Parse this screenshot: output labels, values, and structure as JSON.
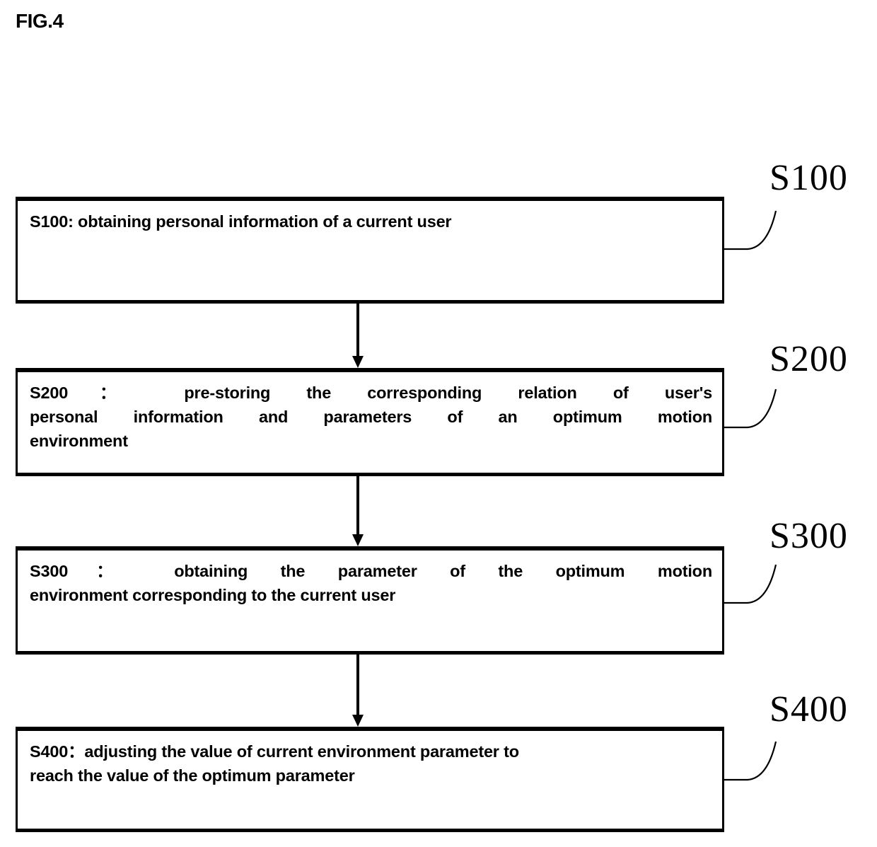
{
  "figure": {
    "title": "FIG.4",
    "type": "patent-flowchart",
    "background_color": "#ffffff",
    "line_color": "#000000"
  },
  "steps": [
    {
      "id": "S100",
      "ref_label": "S100",
      "text": "S100: obtaining personal information of a current user",
      "lines": [
        "S100: obtaining personal information of a current user"
      ]
    },
    {
      "id": "S200",
      "ref_label": "S200",
      "text": "S200： pre-storing the corresponding relation of user's personal information and parameters of an optimum motion environment",
      "lines": [
        "S200： pre-storing the corresponding relation of user's",
        "personal information and parameters of an optimum motion",
        "environment"
      ]
    },
    {
      "id": "S300",
      "ref_label": "S300",
      "text": "S300： obtaining the parameter of the optimum motion environment corresponding to the current user",
      "lines": [
        "S300： obtaining the parameter of the optimum motion",
        "environment corresponding to the current user"
      ]
    },
    {
      "id": "S400",
      "ref_label": "S400",
      "text": "S400：adjusting the value of current environment parameter to reach the value of the optimum parameter",
      "lines": [
        "S400：adjusting the value of current environment parameter to",
        "reach the value of the optimum parameter"
      ]
    }
  ],
  "connectors": [
    {
      "from": "S100",
      "to": "S200",
      "style": "arrow-down"
    },
    {
      "from": "S200",
      "to": "S300",
      "style": "arrow-down"
    },
    {
      "from": "S300",
      "to": "S400",
      "style": "arrow-down"
    }
  ]
}
